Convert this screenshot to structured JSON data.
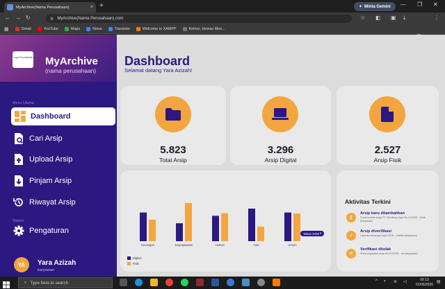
{
  "browser": {
    "tab_title": "MyArchive(Nama Perusahaan)",
    "tab_close": "×",
    "new_tab": "+",
    "gemini_label": "Minta Gemini",
    "url": "MyArchive(Nama Perusahaan).com",
    "bookmarks": [
      {
        "label": "Gmail",
        "color": "#d93025"
      },
      {
        "label": "YouTube",
        "color": "#ff0000"
      },
      {
        "label": "Maps",
        "color": "#34a853"
      },
      {
        "label": "News",
        "color": "#4285f4"
      },
      {
        "label": "Translate",
        "color": "#4285f4"
      },
      {
        "label": "Welcome to XAMPP",
        "color": "#f57c00"
      },
      {
        "label": "Kelinci, Hewan Men...",
        "color": "#777777"
      }
    ]
  },
  "sidebar": {
    "logo_text": "Logo Perusahaan",
    "brand": "MyArchive",
    "brand_sub": "(nama perusahaan)",
    "section_main": "Menu Utama",
    "section_system": "Sistem",
    "items": [
      {
        "label": "Dashboard",
        "icon": "grid-icon",
        "active": true
      },
      {
        "label": "Cari Arsip",
        "icon": "search-doc-icon",
        "active": false
      },
      {
        "label": "Upload Arsip",
        "icon": "upload-doc-icon",
        "active": false
      },
      {
        "label": "Pinjam Arsip",
        "icon": "download-doc-icon",
        "active": false
      },
      {
        "label": "Riwayat Arsip",
        "icon": "history-icon",
        "active": false
      }
    ],
    "settings_label": "Pengaturan",
    "profile": {
      "initials": "YA",
      "name": "Yara Azizah",
      "role": "karyawan"
    }
  },
  "header": {
    "title": "Dashboard",
    "subtitle": "Selamat datang Yara Azizah!"
  },
  "stats": [
    {
      "value": "5.823",
      "label": "Total Arsip",
      "icon": "folder-icon"
    },
    {
      "value": "3.296",
      "label": "Arsip Digital",
      "icon": "laptop-icon"
    },
    {
      "value": "2.527",
      "label": "Arsip Fisik",
      "icon": "document-icon"
    }
  ],
  "chart_data": {
    "type": "bar",
    "year_filter": "Tahun 2026",
    "categories": [
      "Keuangan",
      "Kepegawaian",
      "Hukum",
      "Aset",
      "Umum"
    ],
    "series": [
      {
        "name": "Digital",
        "color": "#2b1880",
        "values": [
          88,
          55,
          78,
          100,
          88
        ]
      },
      {
        "name": "Fisik",
        "color": "#f3a640",
        "values": [
          66,
          117,
          86,
          45,
          85
        ]
      }
    ],
    "legend_position": "bottom-left"
  },
  "activity": {
    "title": "Aktivitas Terkini",
    "items": [
      {
        "icon": "upload-icon",
        "glyph": "↥",
        "title": "Arsip baru ditambahkan",
        "desc": "Surat kontrak kerja PT Gemilang Jaya No.01/2026 – Budi (karyawan)"
      },
      {
        "icon": "check-icon",
        "glyph": "✓",
        "title": "Arsip diverifikasi",
        "desc": "Laporan keuangan April 2026 – Haldia (karyawan)"
      },
      {
        "icon": "rejected-doc-icon",
        "glyph": "✕",
        "title": "Verifikasi ditolak",
        "desc": "Surat perjanjian kerja No.07/2026 – Ira (karyawan)"
      }
    ]
  },
  "taskbar": {
    "search_placeholder": "Type here to search",
    "time": "09.13",
    "date": "01/05/2026"
  }
}
